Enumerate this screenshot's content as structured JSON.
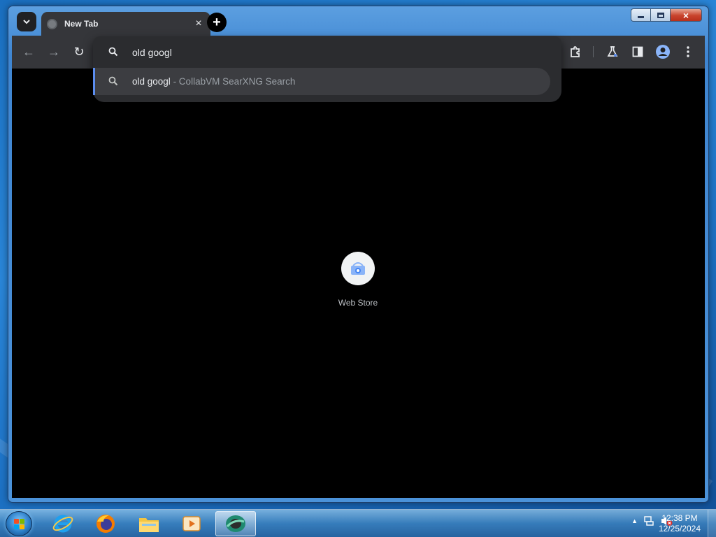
{
  "window": {
    "controls": {
      "minimize": "minimize-icon",
      "maximize": "maximize-icon",
      "close": "×"
    }
  },
  "tab": {
    "title": "New Tab",
    "close": "×"
  },
  "tabstrip": {
    "newtab": "+"
  },
  "toolbar": {
    "back_icon": "←",
    "forward_icon": "→",
    "reload_icon": "↻"
  },
  "omnibox": {
    "value": "old googl",
    "suggestion": {
      "query": "old googl",
      "provider": " - CollabVM SearXNG Search"
    }
  },
  "content": {
    "shortcut": {
      "label": "Web Store"
    }
  },
  "taskbar": {
    "apps": [
      "internet-explorer-icon",
      "firefox-icon",
      "file-explorer-icon",
      "media-player-icon",
      "chrome-icon"
    ],
    "clock": {
      "time": "12:38 PM",
      "date": "12/25/2024"
    },
    "tray_arrow": "▲"
  },
  "colors": {
    "omnibox_accent": "#5b8def",
    "browser_dark": "#35363a",
    "content_bg": "#000000"
  }
}
